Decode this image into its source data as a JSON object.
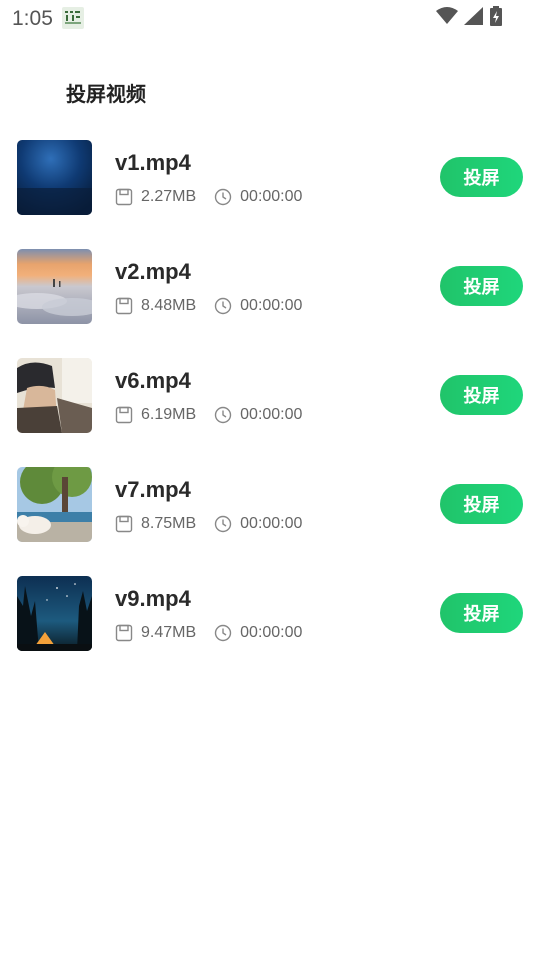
{
  "status_bar": {
    "time": "1:05",
    "icons": [
      "app-notification-icon",
      "wifi-icon",
      "cellular-signal-icon",
      "battery-charging-icon"
    ]
  },
  "page": {
    "title": "投屏视频"
  },
  "videos": [
    {
      "name": "v1.mp4",
      "size": "2.27MB",
      "duration": "00:00:00",
      "button": "投屏",
      "thumb": "deep-blue-water-thumbnail"
    },
    {
      "name": "v2.mp4",
      "size": "8.48MB",
      "duration": "00:00:00",
      "button": "投屏",
      "thumb": "sunset-over-clouds-thumbnail"
    },
    {
      "name": "v6.mp4",
      "size": "6.19MB",
      "duration": "00:00:00",
      "button": "投屏",
      "thumb": "anime-character-thumbnail"
    },
    {
      "name": "v7.mp4",
      "size": "8.75MB",
      "duration": "00:00:00",
      "button": "投屏",
      "thumb": "dog-under-tree-thumbnail"
    },
    {
      "name": "v9.mp4",
      "size": "9.47MB",
      "duration": "00:00:00",
      "button": "投屏",
      "thumb": "starry-night-tent-thumbnail"
    }
  ],
  "colors": {
    "accent": "#1fcd70",
    "text_primary": "#2a2a2a",
    "text_secondary": "#666666"
  }
}
